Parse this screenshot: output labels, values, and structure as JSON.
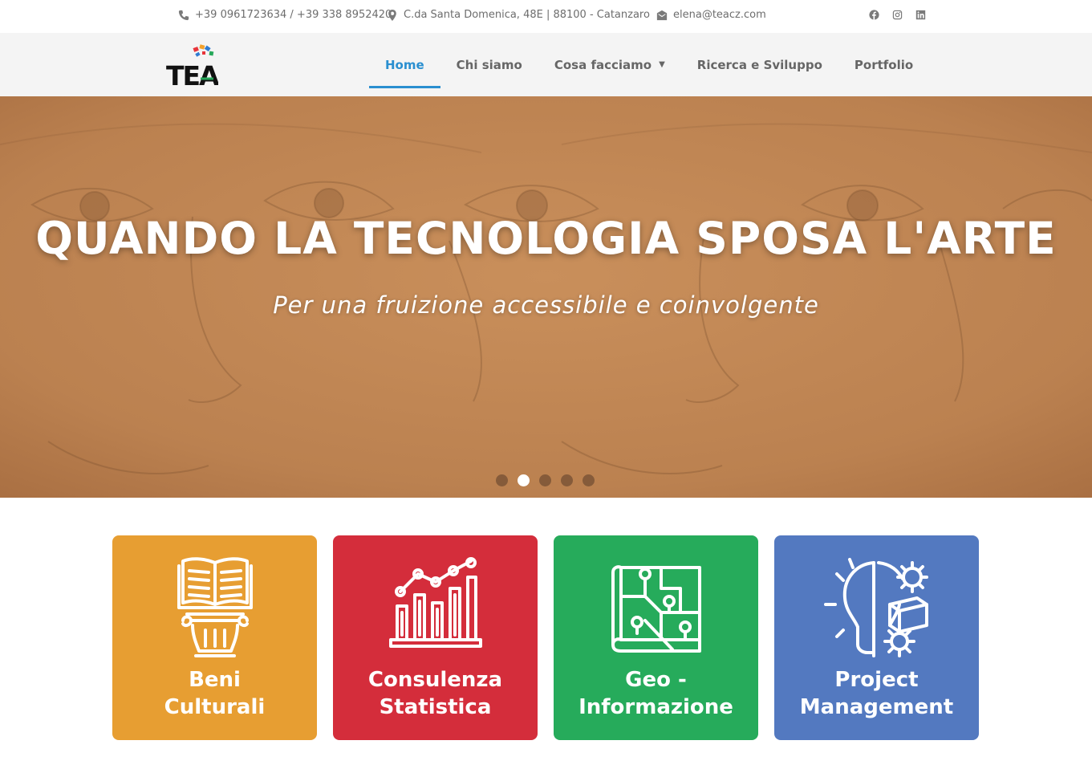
{
  "contacts": {
    "phone": "+39 0961723634 / +39 338 8952420",
    "address": "C.da Santa Domenica, 48E | 88100 - Catanzaro",
    "email": "elena@teacz.com"
  },
  "social": [
    "facebook-icon",
    "instagram-icon",
    "linkedin-icon"
  ],
  "logo": {
    "text": "TEA"
  },
  "nav": {
    "items": [
      {
        "label": "Home",
        "active": true
      },
      {
        "label": "Chi siamo"
      },
      {
        "label": "Cosa facciamo",
        "dropdown": true
      },
      {
        "label": "Ricerca e Sviluppo"
      },
      {
        "label": "Portfolio"
      }
    ]
  },
  "hero": {
    "title": "QUANDO LA TECNOLOGIA SPOSA L'ARTE",
    "subtitle": "Per una fruizione accessibile e coinvolgente",
    "slides": 5,
    "active_slide": 2
  },
  "cards": [
    {
      "line1": "Beni",
      "line2": "Culturali",
      "color": "#e79e32",
      "icon": "book-column-icon"
    },
    {
      "line1": "Consulenza",
      "line2": "Statistica",
      "color": "#d42d3b",
      "icon": "chart-icon"
    },
    {
      "line1": "Geo -",
      "line2": "Informazione",
      "color": "#26ab5b",
      "icon": "map-icon"
    },
    {
      "line1": "Project",
      "line2": "Management",
      "color": "#5379c0",
      "icon": "lightbulb-gear-icon"
    }
  ],
  "colors": {
    "accent": "#2a8fd0",
    "hero_bg": "#bf8552"
  }
}
